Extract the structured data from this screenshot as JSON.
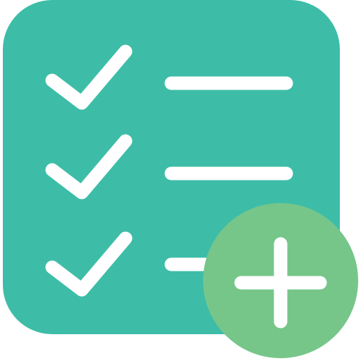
{
  "icon": {
    "name": "add-checklist-icon",
    "colors": {
      "board": "#3DBDA7",
      "badge": "#76C68A",
      "stroke": "#FFFFFF",
      "background": "#FFFFFF"
    },
    "checklist_rows": 3,
    "badge_symbol": "plus-icon"
  }
}
